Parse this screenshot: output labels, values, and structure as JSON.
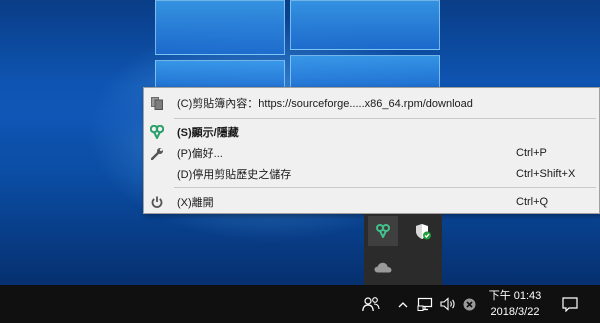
{
  "context_menu": {
    "items": [
      {
        "label": "(C)剪貼簿內容：https://sourceforge.....x86_64.rpm/download",
        "shortcut": "",
        "icon": "clipboard-icon",
        "bold": false
      },
      {
        "label": "(S)顯示/隱藏",
        "shortcut": "",
        "icon": "app-icon",
        "bold": true
      },
      {
        "label": "(P)偏好...",
        "shortcut": "Ctrl+P",
        "icon": "wrench-icon",
        "bold": false
      },
      {
        "label": "(D)停用剪貼歷史之儲存",
        "shortcut": "Ctrl+Shift+X",
        "icon": "",
        "bold": false
      },
      {
        "label": "(X)離開",
        "shortcut": "Ctrl+Q",
        "icon": "power-icon",
        "bold": false
      }
    ]
  },
  "tray_overflow": {
    "icons": [
      "clipboard-app-icon",
      "windows-defender-icon",
      "onedrive-icon"
    ]
  },
  "taskbar": {
    "clock": {
      "time": "下午 01:43",
      "date": "2018/3/22"
    },
    "tray_icons": [
      "people-icon",
      "show-hidden-icons-chevron",
      "network-icon",
      "volume-icon",
      "close-notification-icon",
      "action-center-icon"
    ]
  },
  "colors": {
    "menu_bg": "#f0f0f0",
    "taskbar_bg": "#101010",
    "flyout_bg": "#2b2b2b",
    "defender_green": "#1f9d3a",
    "app_icon_green": "#2aa06a"
  }
}
